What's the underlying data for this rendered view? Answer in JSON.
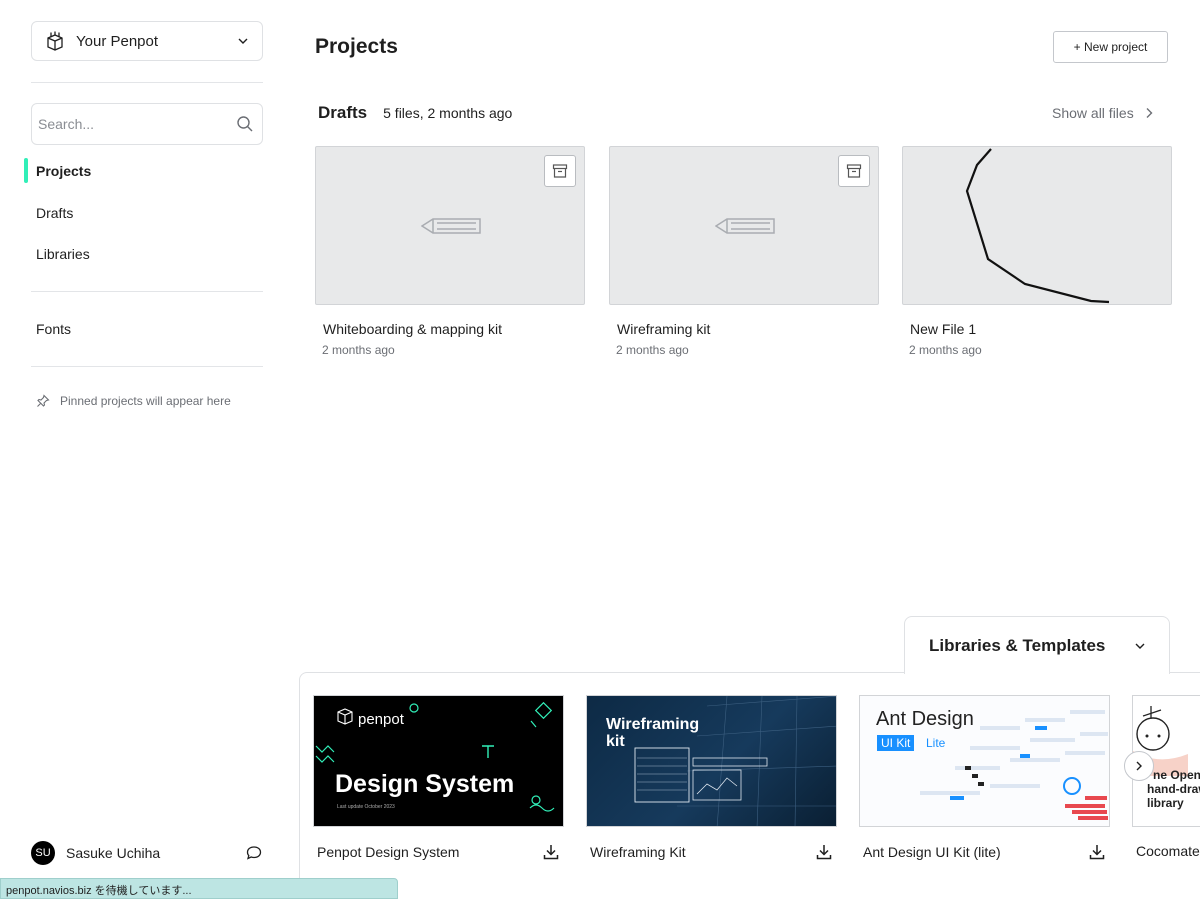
{
  "sidebar": {
    "team_name": "Your Penpot",
    "search_placeholder": "Search...",
    "nav": [
      "Projects",
      "Drafts",
      "Libraries"
    ],
    "fonts_label": "Fonts",
    "pinned_hint": "Pinned projects will appear here",
    "profile": {
      "initials": "SU",
      "name": "Sasuke Uchiha"
    }
  },
  "main": {
    "title": "Projects",
    "new_project_label": "+ New project",
    "drafts": {
      "title": "Drafts",
      "meta": "5 files, 2 months ago",
      "show_all": "Show all files"
    },
    "files": [
      {
        "name": "Whiteboarding & mapping kit",
        "date": "2 months ago"
      },
      {
        "name": "Wireframing kit",
        "date": "2 months ago"
      },
      {
        "name": "New File 1",
        "date": "2 months ago"
      }
    ]
  },
  "libraries": {
    "title": "Libraries & Templates",
    "templates": [
      {
        "name": "Penpot Design System",
        "logo": "penpot",
        "headline": "Design System",
        "sub": "Last update October 2023"
      },
      {
        "name": "Wireframing Kit",
        "headline": "Wireframing kit"
      },
      {
        "name": "Ant Design UI Kit (lite)",
        "headline": "Ant Design",
        "badge": "UI Kit",
        "badge2": "Lite"
      },
      {
        "name": "Cocomate",
        "l1": "ne Open",
        "l2": "hand-draw",
        "l3": "library"
      }
    ]
  },
  "status": "penpot.navios.biz を待機しています...",
  "colors": {
    "accent": "#31efb8",
    "status_bg": "#bde5e3",
    "ant_blue": "#1890ff"
  }
}
